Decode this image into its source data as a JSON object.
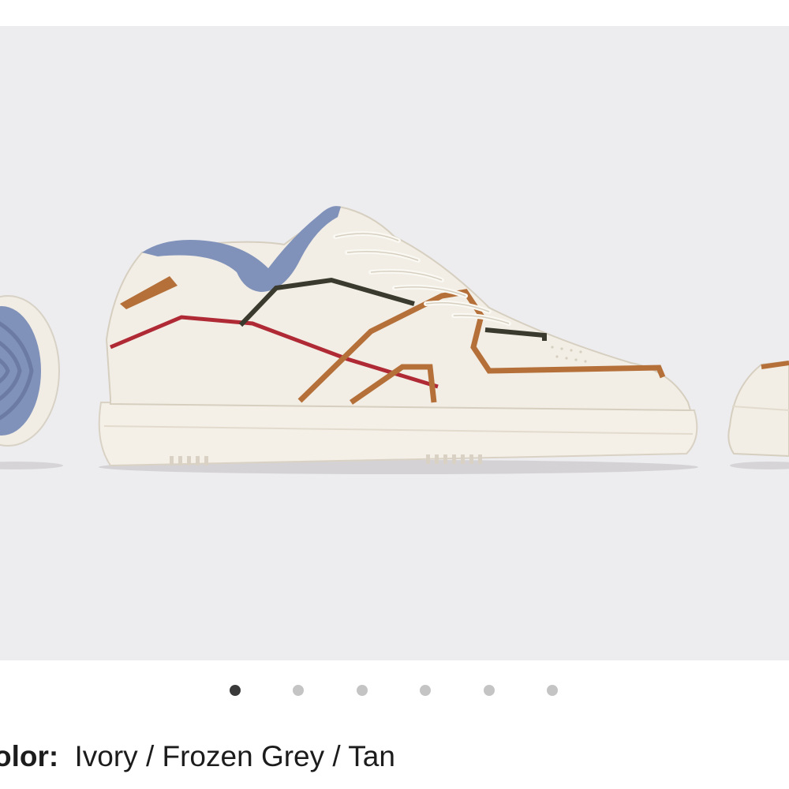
{
  "gallery": {
    "background": "#ededf0",
    "carousel": {
      "active_index": 0,
      "slides": [
        {
          "index": 1
        },
        {
          "index": 2
        },
        {
          "index": 3
        },
        {
          "index": 4
        },
        {
          "index": 5
        },
        {
          "index": 6
        }
      ]
    }
  },
  "product": {
    "color_label": "olor:",
    "color_value": "Ivory / Frozen Grey / Tan"
  },
  "colors": {
    "ivory": "#f1ede4",
    "frozen_grey": "#8192ba",
    "tan": "#b5703a",
    "red": "#b02a36",
    "dark_green": "#3a3b2e",
    "dot_active": "#3a3a3a",
    "dot_inactive": "#c4c4c4"
  }
}
